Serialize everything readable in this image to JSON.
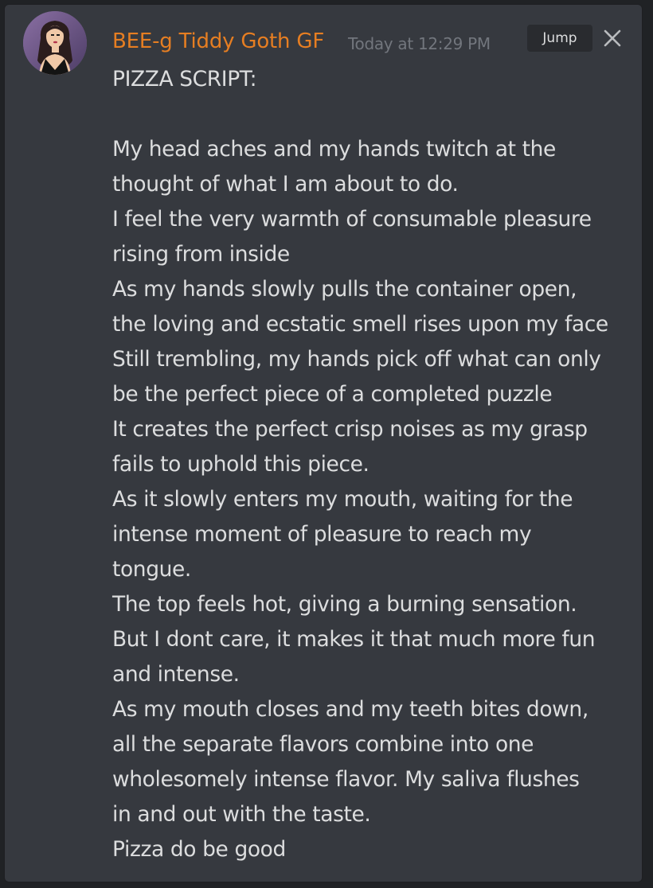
{
  "message": {
    "author": "BEE-g Tiddy Goth GF",
    "author_color": "#e67e22",
    "timestamp": "Today at 12:29 PM",
    "jump_label": "Jump",
    "avatar_icon": "avatar-woman-dark-hair",
    "close_icon": "close-icon",
    "lines": [
      "PIZZA SCRIPT:",
      "",
      "My head aches and my hands twitch at the",
      "thought of what I am about to do.",
      "I feel the very warmth of consumable pleasure",
      "rising from inside",
      "As my hands slowly pulls the container open,",
      "the loving and ecstatic smell rises upon my face",
      "Still trembling, my hands pick off what can only",
      "be the perfect piece of a completed puzzle",
      "It creates the perfect crisp noises as my grasp",
      "fails to uphold this piece.",
      "As it slowly enters my mouth, waiting for the",
      "intense moment of pleasure to reach my",
      "tongue.",
      "The top feels hot, giving a burning sensation.",
      "But I dont care, it makes it that much more fun",
      "and intense.",
      "As my mouth closes and my teeth bites down,",
      "all the separate flavors combine into one",
      "wholesomely intense flavor. My saliva flushes",
      "in and out with the taste.",
      "Pizza do be good"
    ]
  }
}
